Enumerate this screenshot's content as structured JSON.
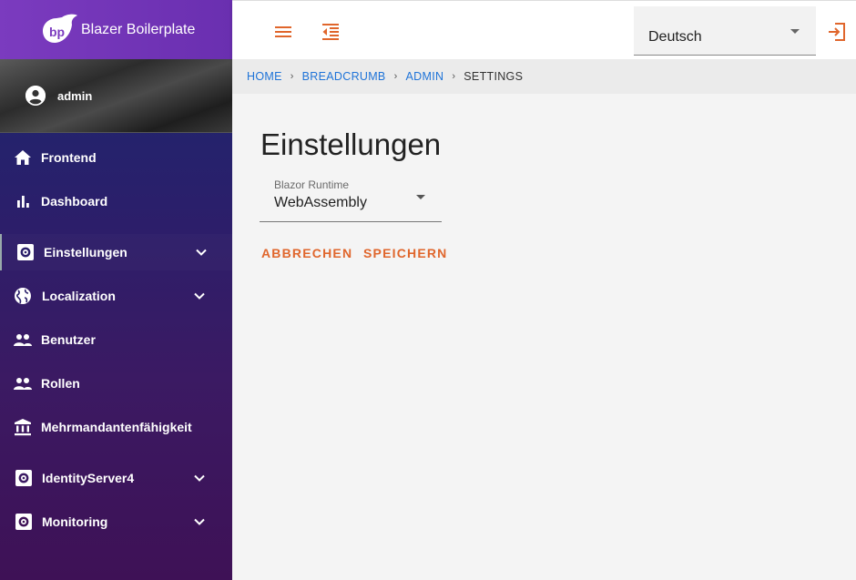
{
  "app": {
    "title": "Blazer Boilerplate",
    "logo_text": "bp",
    "brand_color": "#7b3bbf",
    "accent_color": "#e0662c"
  },
  "user": {
    "name": "admin"
  },
  "sidebar": {
    "items": [
      {
        "label": "Frontend",
        "icon": "home-icon"
      },
      {
        "label": "Dashboard",
        "icon": "bar-chart-icon"
      },
      {
        "label": "Einstellungen",
        "icon": "gear-icon",
        "expandable": true,
        "active": true
      },
      {
        "label": "Localization",
        "icon": "globe-icon",
        "expandable": true
      },
      {
        "label": "Benutzer",
        "icon": "people-icon"
      },
      {
        "label": "Rollen",
        "icon": "people-icon"
      },
      {
        "label": "Mehrmandantenfähigkeit",
        "icon": "bank-icon"
      },
      {
        "label": "IdentityServer4",
        "icon": "gear-icon",
        "expandable": true
      },
      {
        "label": "Monitoring",
        "icon": "gear-icon",
        "expandable": true
      }
    ]
  },
  "topbar": {
    "menu_icon": "menu-icon",
    "collapse_icon": "format-indent-decrease-icon",
    "language": "Deutsch",
    "logout_icon": "logout-icon"
  },
  "breadcrumb": {
    "items": [
      "HOME",
      "BREADCRUMB",
      "ADMIN"
    ],
    "current": "SETTINGS"
  },
  "main": {
    "title": "Einstellungen",
    "runtime_label": "Blazor Runtime",
    "runtime_value": "WebAssembly",
    "cancel_label": "ABBRECHEN",
    "save_label": "SPEICHERN"
  }
}
